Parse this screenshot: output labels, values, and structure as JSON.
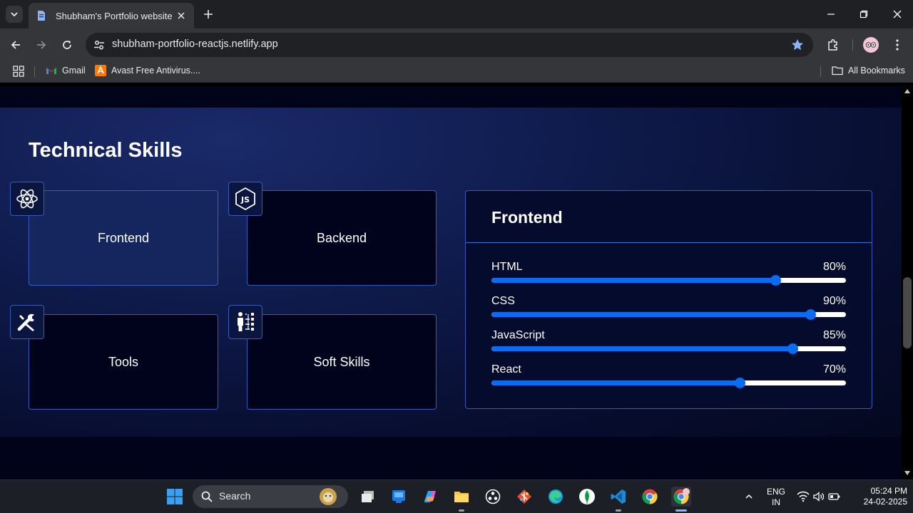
{
  "browser": {
    "tab_title": "Shubham's Portfolio website",
    "url": "shubham-portfolio-reactjs.netlify.app",
    "bookmarks": [
      {
        "label": "Gmail",
        "icon": "gmail-icon"
      },
      {
        "label": "Avast Free Antivirus....",
        "icon": "avast-icon"
      }
    ],
    "all_bookmarks_label": "All Bookmarks"
  },
  "page": {
    "section_title": "Technical Skills",
    "cards": [
      {
        "label": "Frontend",
        "icon": "react-icon",
        "active": true
      },
      {
        "label": "Backend",
        "icon": "nodejs-icon",
        "active": false
      },
      {
        "label": "Tools",
        "icon": "tools-icon",
        "active": false
      },
      {
        "label": "Soft Skills",
        "icon": "soft-skills-icon",
        "active": false
      }
    ],
    "detail": {
      "title": "Frontend",
      "skills": [
        {
          "name": "HTML",
          "percent_label": "80%",
          "value": 0.8
        },
        {
          "name": "CSS",
          "percent_label": "90%",
          "value": 0.9
        },
        {
          "name": "JavaScript",
          "percent_label": "85%",
          "value": 0.85
        },
        {
          "name": "React",
          "percent_label": "70%",
          "value": 0.7
        }
      ]
    }
  },
  "taskbar": {
    "search_placeholder": "Search",
    "lang_line1": "ENG",
    "lang_line2": "IN",
    "time": "05:24 PM",
    "date": "24-02-2025"
  },
  "colors": {
    "accent": "#0a6cf0",
    "card_border": "#3a5ab8",
    "active_card": "#15265f",
    "page_bg": "#01031a"
  }
}
